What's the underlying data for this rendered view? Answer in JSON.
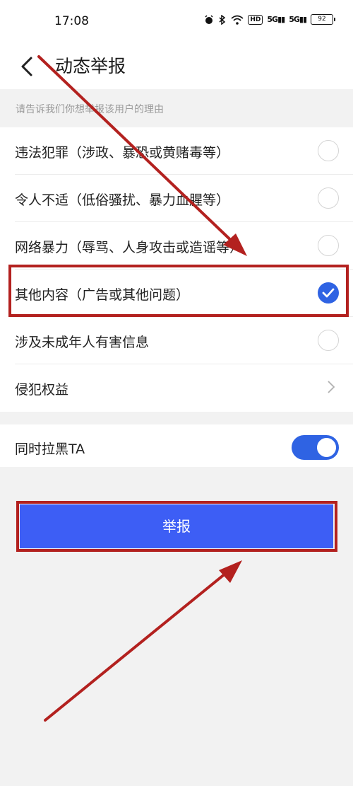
{
  "status": {
    "time": "17:08",
    "hd": "HD",
    "signal1": "5G",
    "signal2": "5G",
    "battery": "92"
  },
  "header": {
    "title": "动态举报"
  },
  "hint": "请告诉我们你想举报该用户的理由",
  "options": [
    {
      "label": "违法犯罪（涉政、暴恐或黄赌毒等）",
      "checked": false
    },
    {
      "label": "令人不适（低俗骚扰、暴力血腥等）",
      "checked": false
    },
    {
      "label": "网络暴力（辱骂、人身攻击或造谣等）",
      "checked": false
    },
    {
      "label": "其他内容（广告或其他问题）",
      "checked": true
    },
    {
      "label": "涉及未成年人有害信息",
      "checked": false
    },
    {
      "label": "侵犯权益",
      "checked": false
    }
  ],
  "block": {
    "label": "同时拉黑TA",
    "enabled": true
  },
  "submit_label": "举报",
  "colors": {
    "accent": "#2f63e3",
    "button": "#3d5ef5",
    "annotation": "#b3211f"
  }
}
